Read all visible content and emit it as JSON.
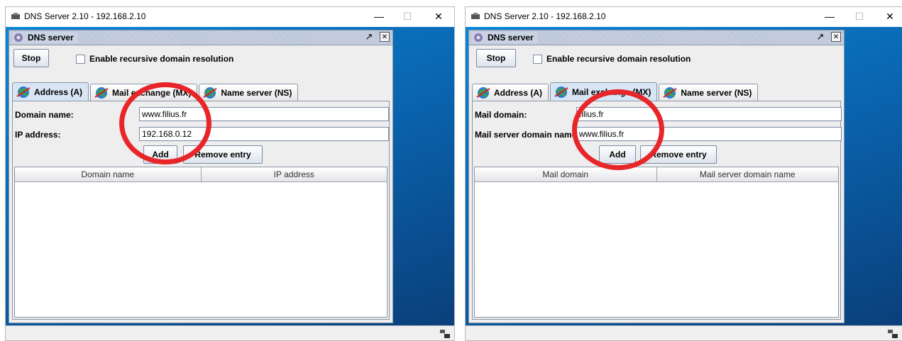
{
  "left": {
    "window_title": "DNS Server 2.10 - 192.168.2.10",
    "window_controls": {
      "minimize": "—",
      "maximize": "☐",
      "close": "✕"
    },
    "panel_title": "DNS server",
    "stop_label": "Stop",
    "recursive_label": "Enable recursive domain resolution",
    "tabs": [
      {
        "label": "Address (A)",
        "active": true
      },
      {
        "label": "Mail exchange (MX)",
        "active": false
      },
      {
        "label": "Name server (NS)",
        "active": false
      }
    ],
    "field1_label": "Domain name:",
    "field1_value": "www.filius.fr",
    "field2_label": "IP address:",
    "field2_value": "192.168.0.12",
    "add_label": "Add",
    "remove_label": "Remove entry",
    "columns": [
      "Domain name",
      "IP address"
    ]
  },
  "right": {
    "window_title": "DNS Server 2.10 - 192.168.2.10",
    "window_controls": {
      "minimize": "—",
      "maximize": "☐",
      "close": "✕"
    },
    "panel_title": "DNS server",
    "stop_label": "Stop",
    "recursive_label": "Enable recursive domain resolution",
    "tabs": [
      {
        "label": "Address (A)",
        "active": false
      },
      {
        "label": "Mail exchange (MX)",
        "active": true
      },
      {
        "label": "Name server (NS)",
        "active": false
      }
    ],
    "field1_label": "Mail domain:",
    "field1_value": "filius.fr",
    "field2_label": "Mail server domain name",
    "field2_value": "www.filius.fr",
    "add_label": "Add",
    "remove_label": "Remove entry",
    "columns": [
      "Mail domain",
      "Mail server domain name"
    ]
  },
  "colors": {
    "annotation_circle": "#e8262a",
    "desktop": "#0a5fa8"
  }
}
